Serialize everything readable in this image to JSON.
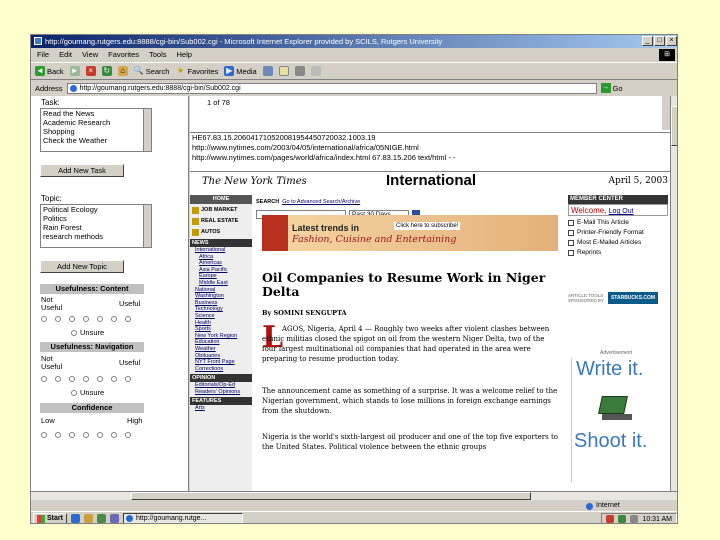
{
  "window": {
    "title": "http://goumang.rutgers.edu:8888/cgi-bin/Sub002.cgi - Microsoft Internet Explorer provided by SCILS, Rutgers University"
  },
  "menu": [
    "File",
    "Edit",
    "View",
    "Favorites",
    "Tools",
    "Help"
  ],
  "toolbar": {
    "back": "Back",
    "search": "Search",
    "favorites": "Favorites",
    "media": "Media"
  },
  "address": {
    "label": "Address",
    "url": "http://goumang.rutgers.edu:8888/cgi-bin/Sub002.cgi",
    "go": "Go"
  },
  "left": {
    "task_label": "Task:",
    "tasks": [
      "Read the News",
      "Academic Research",
      "Shopping",
      "Check the Weather"
    ],
    "add_task": "Add New Task",
    "topic_label": "Topic:",
    "topics": [
      "Political Ecology",
      "Politics",
      "Rain Forest",
      "research methods"
    ],
    "add_topic": "Add New Topic",
    "usefulness_content": "Usefulness: Content",
    "usefulness_navigation": "Usefulness: Navigation",
    "not_useful": "Not Useful",
    "useful": "Useful",
    "unsure": "Unsure",
    "confidence": "Confidence",
    "low": "Low",
    "high": "High"
  },
  "content": {
    "counter": "1 of 78",
    "header_lines": [
      "HE67.83.15.206041710520081954450720032.1003.19",
      "http://www.nytimes.com/2003/04/05/international/africa/05NIGE.html",
      "http://www.nytimes.com/pages/world/africa/index.html 67.83.15.206 text/html - -"
    ]
  },
  "nyt": {
    "logo": "The New York Times",
    "section": "International",
    "date": "April 5, 2003",
    "nav_home": "HOME",
    "nav_buttons": [
      "JOB MARKET",
      "REAL ESTATE",
      "AUTOS"
    ],
    "nav_news": "NEWS",
    "nav_links": [
      "International",
      "Africa",
      "Americas",
      "Asia Pacific",
      "Europe",
      "Middle East",
      "National",
      "Washington",
      "Business",
      "Technology",
      "Science",
      "Health",
      "Sports",
      "New York Region",
      "Education",
      "Weather",
      "Obituaries",
      "NYT Front Page",
      "Corrections"
    ],
    "nav_opinion": "OPINION",
    "opinion_links": [
      "Editorials/Op-Ed",
      "Readers' Opinions"
    ],
    "nav_features": "FEATURES",
    "features_links": [
      "Arts"
    ],
    "search_label": "SEARCH",
    "search_link": "Go to Advanced Search/Archive",
    "search_range": "Past 30 Days",
    "ad_title": "Latest trends in",
    "ad_subtitle": "Fashion, Cuisine and Entertaining",
    "ad_subscribe": "Click here to subscribe!",
    "headline": "Oil Companies to Resume Work in Niger Delta",
    "byline": "By SOMINI SENGUPTA",
    "dropcap": "L",
    "para1": "AGOS, Nigeria, April 4 — Roughly two weeks after violent clashes between ethnic militias closed the spigot on oil from the western Niger Delta, two of the four largest multinational oil companies that had operated in the area were preparing to resume production today.",
    "para2": "The announcement came as something of a surprise. It was a welcome relief to the Nigerian government, which stands to lose millions in foreign exchange earnings from the shutdown.",
    "para3": "Nigeria is the world's sixth-largest oil producer and one of the top five exporters to the United States. Political violence between the ethnic groups",
    "member_center": "MEMBER CENTER",
    "welcome": "Welcome,",
    "log_out": "Log Out",
    "tools": [
      "E-Mail This Article",
      "Printer-Friendly Format",
      "Most E-Mailed Articles",
      "Reprints"
    ],
    "sponsor_text": "ARTICLE TOOLS SPONSORED BY",
    "sponsor": "STARBUCKS.COM",
    "advertisement": "Advertisement",
    "ad_write": "Write it.",
    "ad_shoot": "Shoot it."
  },
  "status": {
    "zone": "Internet"
  },
  "taskbar": {
    "start": "Start",
    "item": "http://goumang.rutge...",
    "clock": "10:31 AM"
  }
}
